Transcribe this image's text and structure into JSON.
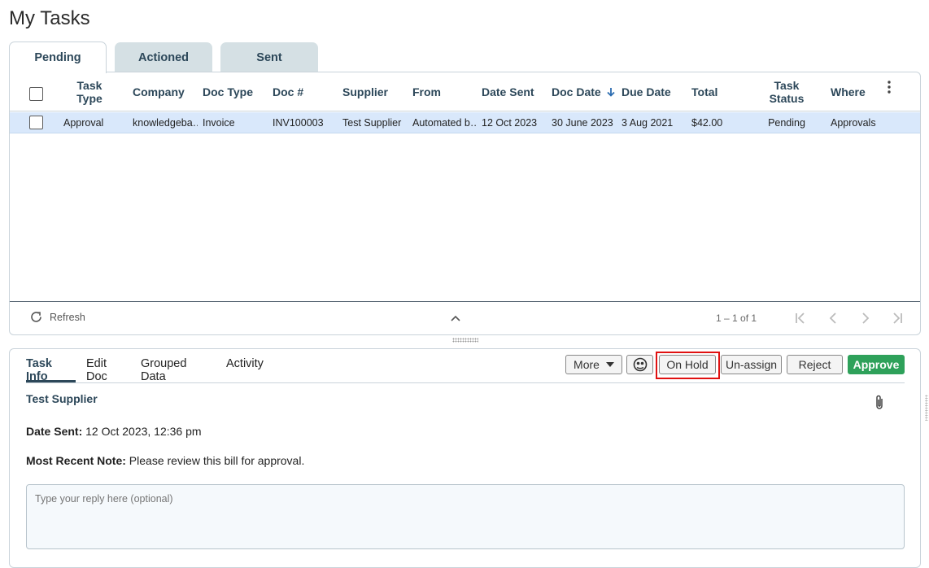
{
  "page": {
    "title": "My Tasks"
  },
  "tabs": [
    {
      "label": "Pending",
      "active": true
    },
    {
      "label": "Actioned",
      "active": false
    },
    {
      "label": "Sent",
      "active": false
    }
  ],
  "table": {
    "columns": {
      "task_type_1": "Task",
      "task_type_2": "Type",
      "company": "Company",
      "doc_type": "Doc Type",
      "doc_num": "Doc #",
      "supplier": "Supplier",
      "from": "From",
      "date_sent": "Date Sent",
      "doc_date": "Doc Date",
      "due_date": "Due Date",
      "total": "Total",
      "task_status_1": "Task",
      "task_status_2": "Status",
      "where": "Where"
    },
    "rows": [
      {
        "task_type": "Approval",
        "company": "knowledgeba…",
        "doc_type": "Invoice",
        "doc_num": "INV100003",
        "supplier": "Test Supplier",
        "from": "Automated b…",
        "date_sent": "12 Oct 2023",
        "doc_date": "30 June 2023",
        "due_date": "3 Aug 2021",
        "total": "$42.00",
        "task_status": "Pending",
        "where": "Approvals"
      }
    ],
    "footer": {
      "refresh_label": "Refresh",
      "pager_text": "1 – 1 of 1"
    }
  },
  "detail": {
    "subtabs": [
      "Task Info",
      "Edit Doc",
      "Grouped Data",
      "Activity"
    ],
    "actions": {
      "more": "More",
      "on_hold": "On Hold",
      "unassign": "Un-assign",
      "reject": "Reject",
      "approve": "Approve"
    },
    "supplier_name": "Test Supplier",
    "date_sent_label": "Date Sent:",
    "date_sent_value": "12 Oct 2023, 12:36 pm",
    "note_label": "Most Recent Note:",
    "note_value": "Please review this bill for approval.",
    "reply_placeholder": "Type your reply here (optional)"
  },
  "colors": {
    "accent": "#2c4759",
    "selected_row": "#d9e8fb",
    "approve": "#2ea15a",
    "highlight": "#e01010"
  }
}
